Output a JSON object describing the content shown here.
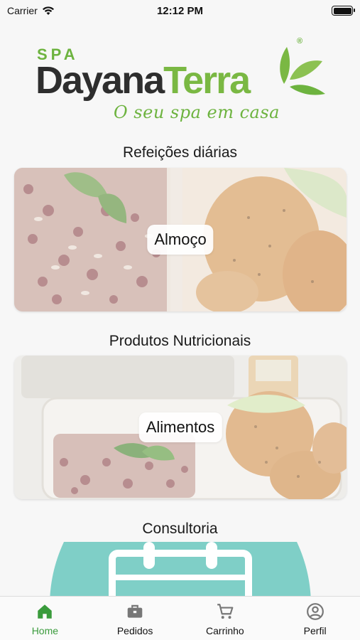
{
  "status_bar": {
    "carrier": "Carrier",
    "time": "12:12 PM"
  },
  "logo": {
    "spa": "SPA",
    "brand_part1": "Dayana",
    "brand_part2": "Terra",
    "registered": "®",
    "tagline": "O seu spa em casa"
  },
  "sections": {
    "meals": {
      "title": "Refeições diárias",
      "card_label": "Almoço"
    },
    "products": {
      "title": "Produtos Nutricionais",
      "card_label": "Alimentos"
    },
    "consulting": {
      "title": "Consultoria"
    }
  },
  "tab_bar": {
    "items": [
      {
        "label": "Home",
        "icon": "home-icon",
        "active": true
      },
      {
        "label": "Pedidos",
        "icon": "briefcase-icon",
        "active": false
      },
      {
        "label": "Carrinho",
        "icon": "cart-icon",
        "active": false
      },
      {
        "label": "Perfil",
        "icon": "profile-icon",
        "active": false
      }
    ]
  },
  "colors": {
    "brand_green": "#6db33f",
    "active_tab": "#3a9b3c",
    "teal": "#7fcfc7"
  }
}
